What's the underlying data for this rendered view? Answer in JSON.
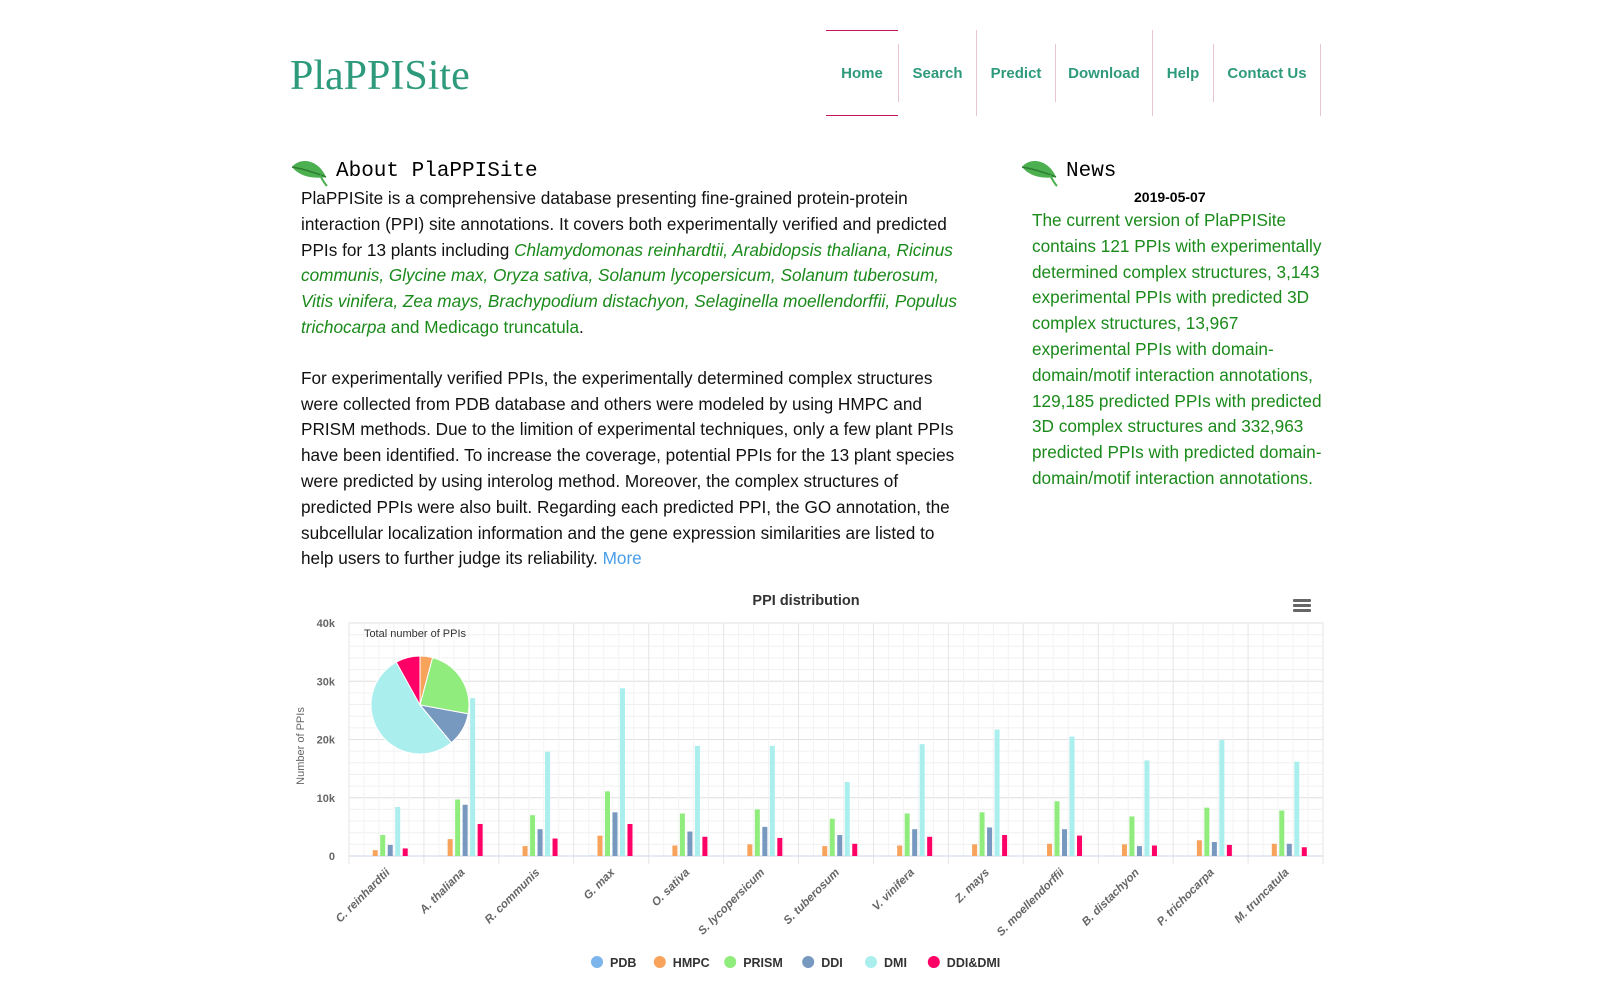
{
  "site": {
    "logo": "PlaPPISite"
  },
  "nav": [
    {
      "label": "Home"
    },
    {
      "label": "Search"
    },
    {
      "label": "Predict"
    },
    {
      "label": "Download"
    },
    {
      "label": "Help"
    },
    {
      "label": "Contact Us"
    }
  ],
  "about": {
    "heading": "About PlaPPISite",
    "p1_start": "PlaPPISite is a comprehensive database presenting fine-grained protein-protein interaction (PPI) site annotations. It covers both experimentally verified and predicted PPIs for 13 plants including ",
    "species_italic": "Chlamydomonas reinhardtii, Arabidopsis thaliana, Ricinus communis, Glycine max, Oryza sativa, Solanum lycopersicum, Solanum tuberosum, Vitis vinifera, Zea mays, Brachypodium distachyon, Selaginella moellendorffii, Populus trichocarpa",
    "species_last": " and Medicago truncatula",
    "p1_end": ".",
    "p2": "For experimentally verified PPIs, the experimentally determined complex structures were collected from PDB database and others were modeled by using HMPC and PRISM methods. Due to the limition of experimental techniques, only a few plant PPIs have been identified. To increase the coverage, potential PPIs for the 13 plant species were predicted by using interolog method. Moreover, the complex structures of predicted PPIs were also built. Regarding each predicted PPI, the GO annotation, the subcellular localization information and the gene expression similarities are listed to help users to further judge its reliability. ",
    "more": "More"
  },
  "news": {
    "heading": "News",
    "date": "2019-05-07",
    "text": "The current version of PlaPPISite contains 121 PPIs with experimentally determined complex structures, 3,143 experimental PPIs with predicted 3D complex structures, 13,967 experimental PPIs with domain-domain/motif interaction annotations, 129,185 predicted PPIs with predicted 3D complex structures and 332,963 predicted PPIs with predicted domain-domain/motif interaction annotations."
  },
  "colors": {
    "brand": "#2e9a7c",
    "species": "#1a8a1a",
    "link": "#4a9eea",
    "nav_active_border": "#c2185b"
  },
  "icons": {
    "section": "leaf-icon",
    "chart_menu": "hamburger-menu-icon"
  },
  "chart_data": {
    "type": "bar",
    "title": "PPI distribution",
    "ylabel": "Number of PPIs",
    "ylim": [
      0,
      40000
    ],
    "yticks": [
      0,
      10000,
      20000,
      30000,
      40000
    ],
    "ytick_labels": [
      "0",
      "10k",
      "20k",
      "30k",
      "40k"
    ],
    "categories": [
      "C. reinhardtii",
      "A. thaliana",
      "R. communis",
      "G. max",
      "O. sativa",
      "S. lycopersicum",
      "S. tuberosum",
      "V. vinifera",
      "Z. mays",
      "S. moellendorffii",
      "B. distachyon",
      "P. trichocarpa",
      "M. truncatula"
    ],
    "series": [
      {
        "name": "PDB",
        "color": "#7cb5ec",
        "values": [
          0,
          10,
          0,
          40,
          0,
          0,
          0,
          0,
          10,
          0,
          0,
          0,
          0
        ]
      },
      {
        "name": "HMPC",
        "color": "#f7a35c",
        "values": [
          1000,
          2900,
          1700,
          3500,
          1800,
          2000,
          1700,
          1800,
          2000,
          2100,
          2000,
          2700,
          2100
        ]
      },
      {
        "name": "PRISM",
        "color": "#90ed7d",
        "values": [
          3600,
          9700,
          7000,
          11100,
          7300,
          8000,
          6400,
          7300,
          7500,
          9400,
          6800,
          8300,
          7800
        ]
      },
      {
        "name": "DDI",
        "color": "#7798bf",
        "values": [
          1900,
          8800,
          4600,
          7500,
          4200,
          5000,
          3600,
          4600,
          4900,
          4600,
          1700,
          2400,
          2100
        ]
      },
      {
        "name": "DMI",
        "color": "#aaeeee",
        "values": [
          8400,
          27100,
          17900,
          28800,
          18900,
          18900,
          12700,
          19200,
          21700,
          20500,
          16400,
          19900,
          16200
        ]
      },
      {
        "name": "DDI&DMI",
        "color": "#ff0066",
        "values": [
          1300,
          5500,
          3000,
          5500,
          3300,
          3100,
          2100,
          3300,
          3600,
          3500,
          1800,
          1900,
          1500
        ]
      }
    ],
    "pie": {
      "title": "Total number of PPIs",
      "values": [
        60,
        19300,
        110900,
        51700,
        247500,
        37700
      ]
    },
    "legend_position": "bottom-center",
    "grid": true
  }
}
